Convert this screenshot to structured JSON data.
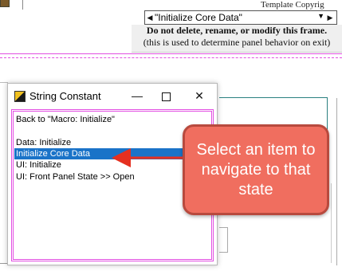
{
  "background": {
    "template_label": "Template Copyrig",
    "case_selector": {
      "value": "\"Initialize Core Data\""
    },
    "note": {
      "line1": "Do not delete, rename, or modify this frame.",
      "line2": "(this is used to determine panel behavior on exit)"
    }
  },
  "window": {
    "title": "String Constant",
    "minimize_glyph": "—",
    "close_glyph": "✕",
    "items": [
      {
        "label": "Back to  \"Macro: Initialize\"",
        "selected": false
      },
      {
        "label": "Data: Initialize",
        "selected": false
      },
      {
        "label": "Initialize Core Data",
        "selected": true
      },
      {
        "label": "UI: Initialize",
        "selected": false
      },
      {
        "label": "UI: Front Panel State >> Open",
        "selected": false
      }
    ]
  },
  "callout": {
    "text": "Select an item to navigate to that state"
  },
  "colors": {
    "selection": "#1a73c8",
    "callout_fill": "#f06e5f",
    "callout_border": "#b84a3e",
    "arrow": "#e53020",
    "magenta": "#e24fe2",
    "wire": "#2a8080"
  }
}
